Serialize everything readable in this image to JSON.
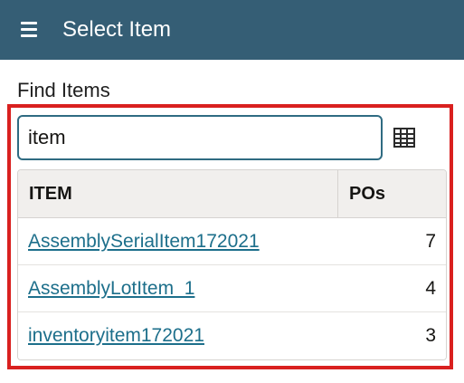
{
  "header": {
    "title": "Select Item",
    "menu_icon": "hamburger-menu-icon",
    "background_color": "#355E75"
  },
  "find": {
    "label": "Find Items",
    "search_value": "item",
    "grid_icon": "grid-view-icon"
  },
  "table": {
    "columns": [
      "ITEM",
      "POs"
    ],
    "rows": [
      {
        "item": "AssemblySerialItem172021",
        "pos": "7"
      },
      {
        "item": "AssemblyLotItem_1",
        "pos": "4"
      },
      {
        "item": "inventoryitem172021",
        "pos": "3"
      }
    ]
  },
  "colors": {
    "link": "#1D6F8B",
    "highlight": "#D9201F",
    "input_border": "#2F6B82"
  }
}
